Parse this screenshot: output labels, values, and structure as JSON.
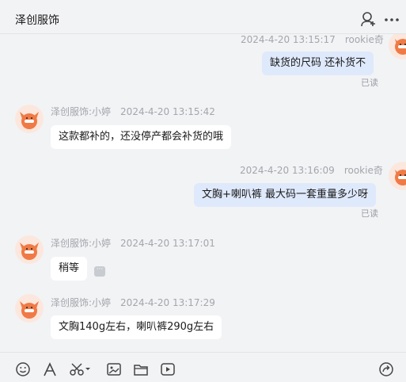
{
  "header": {
    "title": "泽创服饰",
    "icons": [
      "add-user-icon",
      "more-icon"
    ]
  },
  "messages": [
    {
      "sender": "rookie奇",
      "time": "2024-4-20 13:15:17",
      "text": "缺货的尺码  还补货不",
      "status": "已读",
      "direction": "out"
    },
    {
      "sender": "泽创服饰:小婷",
      "time": "2024-4-20 13:15:42",
      "text": "这款都补的，还没停产都会补货的哦",
      "direction": "in"
    },
    {
      "sender": "rookie奇",
      "time": "2024-4-20 13:16:09",
      "text": "文胸+喇叭裤 最大码一套重量多少呀",
      "status": "已读",
      "direction": "out"
    },
    {
      "sender": "泽创服饰:小婷",
      "time": "2024-4-20 13:17:01",
      "text": "稍等",
      "direction": "in"
    },
    {
      "sender": "泽创服饰:小婷",
      "time": "2024-4-20 13:17:29",
      "text": "文胸140g左右，喇叭裤290g左右",
      "direction": "in"
    }
  ],
  "toolbar": {
    "icons": [
      "emoji-icon",
      "font-icon",
      "scissors-icon",
      "image-icon",
      "folder-icon",
      "video-icon",
      "share-icon"
    ]
  },
  "colors": {
    "background": "#f2f3f5",
    "outgoing_bubble": "#dfe9fc",
    "incoming_bubble": "#ffffff",
    "meta_text": "#a3a6ab"
  }
}
